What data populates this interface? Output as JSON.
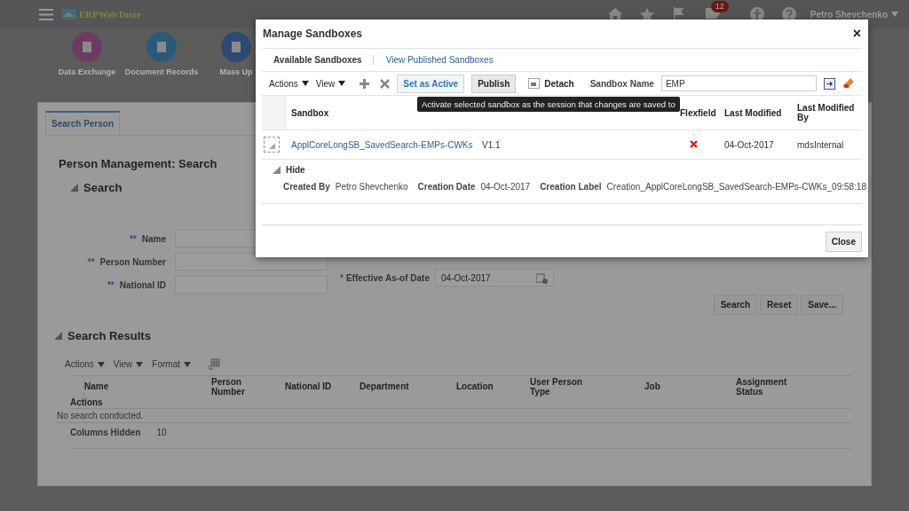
{
  "header": {
    "logo_text": "ERPWebTutor",
    "notification_count": "12",
    "user": "Petro Shevchenko"
  },
  "springboard": [
    {
      "label": "Data Exchange",
      "color": "#6e3a62"
    },
    {
      "label": "Document Records",
      "color": "#2a5a78"
    },
    {
      "label": "Mass Up",
      "color": "#2f4a72"
    }
  ],
  "page": {
    "tabs": [
      {
        "label": "Search Person",
        "selected": true
      }
    ],
    "title": "Person Management: Search",
    "search_section": "Search",
    "fields": [
      {
        "mark": "**",
        "label": "Name"
      },
      {
        "mark": "**",
        "label": "Person Number"
      },
      {
        "mark": "**",
        "label": "National ID"
      }
    ],
    "date_field": {
      "mark": "*",
      "label": "Effective As-of Date",
      "value": "04-Oct-2017"
    },
    "buttons": [
      "Search",
      "Reset",
      "Save..."
    ],
    "results_section": "Search Results",
    "results_toolbar": [
      "Actions",
      "View",
      "Format"
    ],
    "columns": [
      "Name",
      "Person Number",
      "National ID",
      "Department",
      "Location",
      "User Person Type",
      "Job",
      "Assignment Status",
      "Actions"
    ],
    "empty_text": "No search conducted.",
    "hidden_label": "Columns Hidden",
    "hidden_count": "10"
  },
  "dialog": {
    "title": "Manage Sandboxes",
    "close": "×",
    "tabs": [
      {
        "label": "Available Sandboxes",
        "selected": true
      },
      {
        "label": "View Published Sandboxes",
        "selected": false
      }
    ],
    "toolbar": {
      "menus": [
        "Actions",
        "View"
      ],
      "set_active": "Set as Active",
      "publish": "Publish",
      "detach": "Detach",
      "name_label": "Sandbox Name",
      "name_value": "EMP"
    },
    "columns": [
      "Sandbox",
      "",
      "",
      "Flexfield",
      "Last Modified",
      "Last Modified By"
    ],
    "rows": [
      {
        "sandbox": "ApplCoreLongSB_SavedSearch-EMPs-CWKs",
        "description": "V1.1",
        "flexfield": false,
        "last_modified": "04-Oct-2017",
        "modified_by": "mdsInternal",
        "expanded": true,
        "details": {
          "hide_label": "Hide",
          "fields": [
            {
              "label": "Created By",
              "value": "Petro Shevchenko"
            },
            {
              "label": "Creation Date",
              "value": "04-Oct-2017"
            },
            {
              "label": "Creation Label",
              "value": "Creation_ApplCoreLongSB_SavedSearch-EMPs-CWKs_09:58:18"
            }
          ]
        }
      }
    ],
    "close_button": "Close",
    "tooltip": "Activate selected sandbox as the session that changes are saved to"
  }
}
